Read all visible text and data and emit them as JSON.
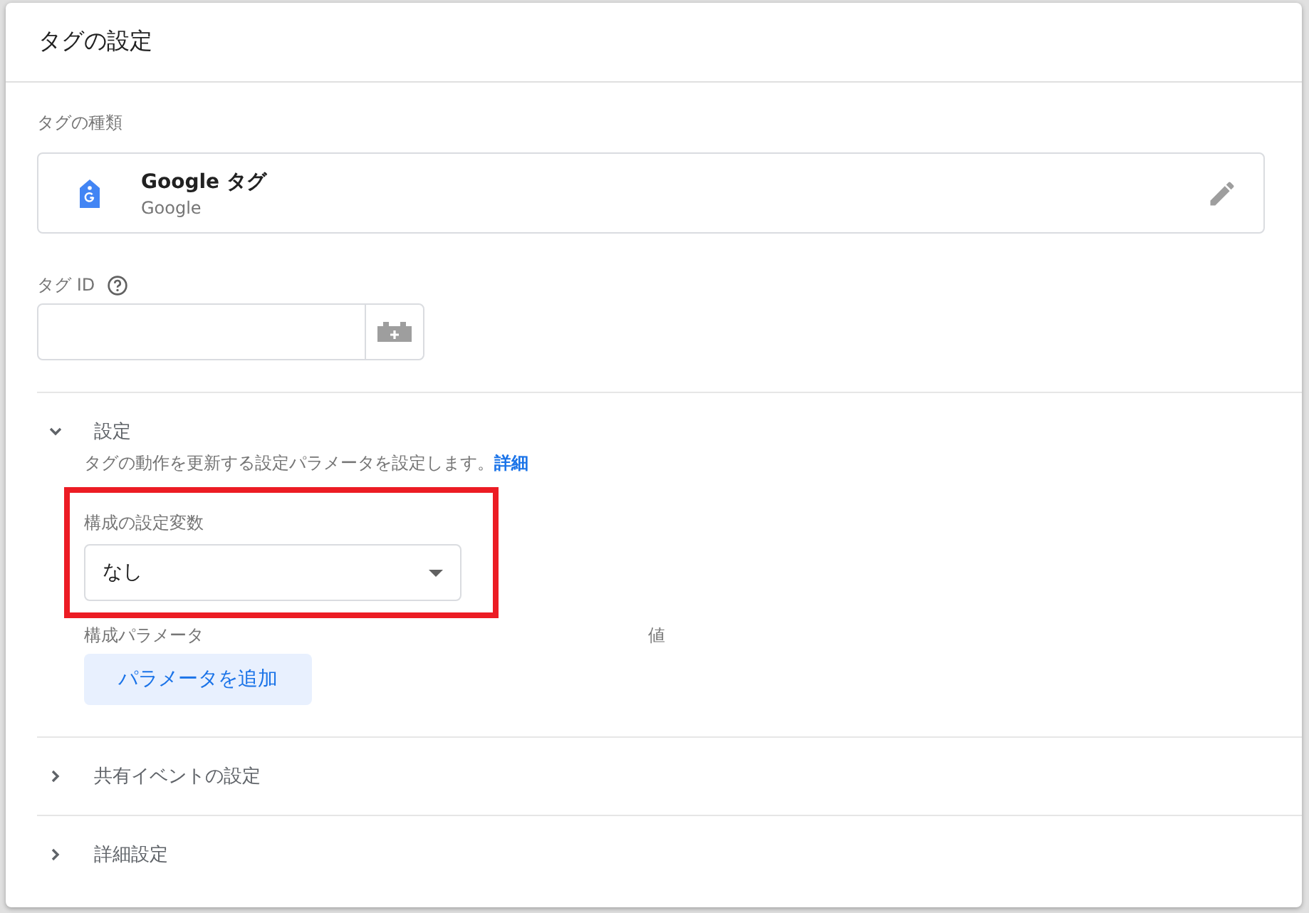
{
  "title": "タグの設定",
  "tag_type": {
    "label": "タグの種類",
    "name": "Google タグ",
    "vendor": "Google"
  },
  "tag_id": {
    "label": "タグ ID"
  },
  "sections": [
    {
      "title": "設定",
      "expanded": true,
      "description": "タグの動作を更新する設定パラメータを設定します。",
      "link": "詳細",
      "config_variable": {
        "label": "構成の設定変数",
        "value": "なし"
      },
      "param_columns": [
        "構成パラメータ",
        "値"
      ],
      "add_button": "パラメータを追加"
    },
    {
      "title": "共有イベントの設定",
      "expanded": false
    },
    {
      "title": "詳細設定",
      "expanded": false
    }
  ]
}
